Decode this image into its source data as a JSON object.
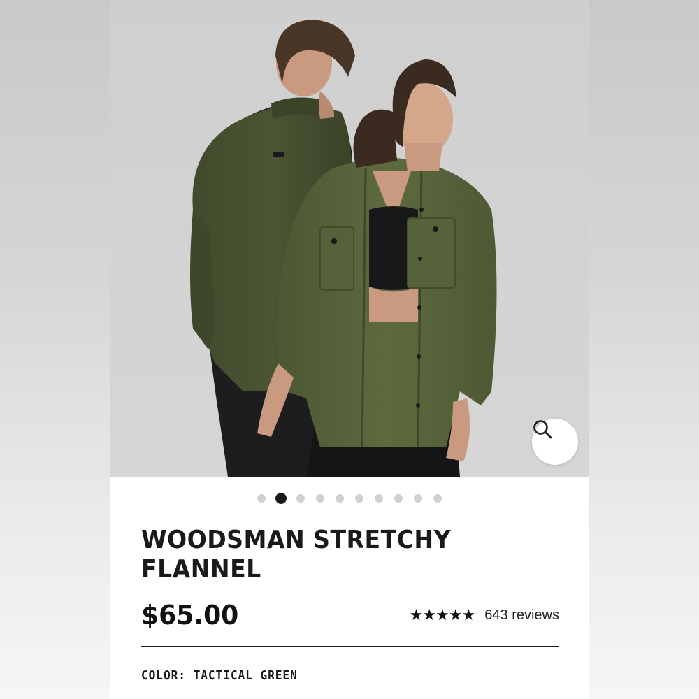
{
  "product": {
    "title": "WOODSMAN STRETCHY FLANNEL",
    "price": "$65.00",
    "rating_stars": "★★★★★",
    "rating_value": 5,
    "review_count": "643 reviews",
    "color_label": "COLOR:",
    "color_value": "TACTICAL GREEN"
  },
  "gallery": {
    "image_count": 10,
    "active_index": 1,
    "zoom_icon": "search-icon"
  },
  "colors": {
    "shirt": "#55603a",
    "background": "#d3d3d3",
    "text": "#1a1a1a"
  }
}
